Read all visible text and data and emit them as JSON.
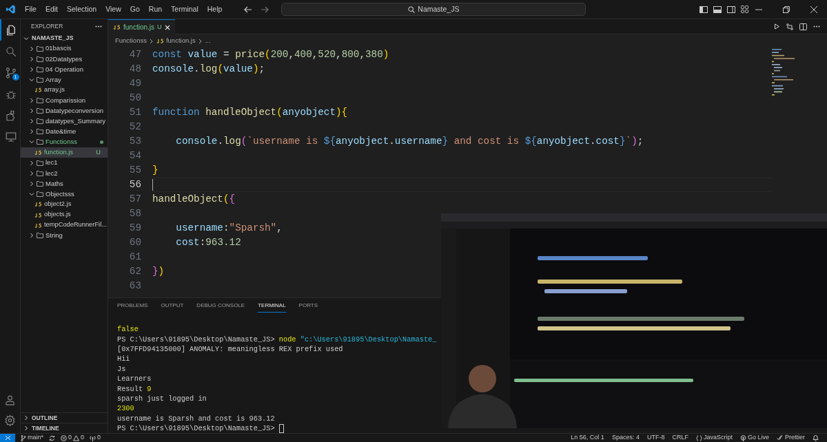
{
  "title_bar": {
    "menu": [
      "File",
      "Edit",
      "Selection",
      "View",
      "Go",
      "Run",
      "Terminal",
      "Help"
    ],
    "search": "Namaste_JS"
  },
  "activity_bar": [
    {
      "kind": "explorer",
      "selected": true
    },
    {
      "kind": "search",
      "selected": false
    },
    {
      "kind": "scm",
      "selected": false,
      "badge": "1"
    },
    {
      "kind": "debug",
      "selected": false
    },
    {
      "kind": "extensions",
      "selected": false
    },
    {
      "kind": "remote",
      "selected": false
    }
  ],
  "explorer": {
    "title": "EXPLORER",
    "root": "NAMASTE_JS",
    "tree": [
      {
        "kind": "folder",
        "label": "01bascis",
        "expanded": false,
        "selected": false,
        "modified": false
      },
      {
        "kind": "folder",
        "label": "02Datatypes",
        "expanded": false,
        "selected": false,
        "modified": false
      },
      {
        "kind": "folder",
        "label": "04 Operation",
        "expanded": false,
        "selected": false,
        "modified": false
      },
      {
        "kind": "folder",
        "label": "Array",
        "expanded": true,
        "selected": false,
        "modified": false,
        "children": [
          {
            "kind": "file",
            "label": "array.js",
            "selected": false,
            "modified": false
          }
        ]
      },
      {
        "kind": "folder",
        "label": "Comparission",
        "expanded": false,
        "selected": false,
        "modified": false
      },
      {
        "kind": "folder",
        "label": "Datatypeconversion",
        "expanded": false,
        "selected": false,
        "modified": false
      },
      {
        "kind": "folder",
        "label": "datatypes_Summary",
        "expanded": false,
        "selected": false,
        "modified": false
      },
      {
        "kind": "folder",
        "label": "Date&time",
        "expanded": false,
        "selected": false,
        "modified": false
      },
      {
        "kind": "folder",
        "label": "Functionss",
        "expanded": true,
        "selected": false,
        "modified": true,
        "children": [
          {
            "kind": "file",
            "label": "function.js",
            "selected": true,
            "modified": true,
            "status": "U"
          }
        ]
      },
      {
        "kind": "folder",
        "label": "lec1",
        "expanded": false,
        "selected": false,
        "modified": false
      },
      {
        "kind": "folder",
        "label": "lec2",
        "expanded": false,
        "selected": false,
        "modified": false
      },
      {
        "kind": "folder",
        "label": "Maths",
        "expanded": false,
        "selected": false,
        "modified": false
      },
      {
        "kind": "folder",
        "label": "Objectsss",
        "expanded": true,
        "selected": false,
        "modified": false,
        "children": [
          {
            "kind": "file",
            "label": "object2.js",
            "selected": false,
            "modified": false
          },
          {
            "kind": "file",
            "label": "objects.js",
            "selected": false,
            "modified": false
          },
          {
            "kind": "file",
            "label": "tempCodeRunnerFil...",
            "selected": false,
            "modified": false
          }
        ]
      },
      {
        "kind": "folder",
        "label": "String",
        "expanded": false,
        "selected": false,
        "modified": false
      }
    ],
    "sections": [
      "OUTLINE",
      "TIMELINE"
    ]
  },
  "editor": {
    "tabs": [
      {
        "label": "function.js",
        "status": "U",
        "selected": true
      }
    ],
    "breadcrumb": [
      "Functionss",
      "function.js",
      "..."
    ],
    "lines": [
      {
        "number": "47",
        "current": false,
        "tokens": [
          {
            "kind": "keyword",
            "text": "const "
          },
          {
            "kind": "variable",
            "text": "value"
          },
          {
            "kind": "plain",
            "text": " = "
          },
          {
            "kind": "function",
            "text": "price"
          },
          {
            "kind": "bracket1",
            "text": "("
          },
          {
            "kind": "number",
            "text": "200"
          },
          {
            "kind": "plain",
            "text": ","
          },
          {
            "kind": "number",
            "text": "400"
          },
          {
            "kind": "plain",
            "text": ","
          },
          {
            "kind": "number",
            "text": "520"
          },
          {
            "kind": "plain",
            "text": ","
          },
          {
            "kind": "number",
            "text": "800"
          },
          {
            "kind": "plain",
            "text": ","
          },
          {
            "kind": "number",
            "text": "380"
          },
          {
            "kind": "bracket1",
            "text": ")"
          }
        ]
      },
      {
        "number": "48",
        "current": false,
        "tokens": [
          {
            "kind": "variable",
            "text": "console"
          },
          {
            "kind": "plain",
            "text": "."
          },
          {
            "kind": "function",
            "text": "log"
          },
          {
            "kind": "bracket1",
            "text": "("
          },
          {
            "kind": "variable",
            "text": "value"
          },
          {
            "kind": "bracket1",
            "text": ")"
          },
          {
            "kind": "plain",
            "text": ";"
          }
        ]
      },
      {
        "number": "49",
        "current": false
      },
      {
        "number": "50",
        "current": false
      },
      {
        "number": "51",
        "current": false,
        "tokens": [
          {
            "kind": "keyword",
            "text": "function "
          },
          {
            "kind": "function",
            "text": "handleObject"
          },
          {
            "kind": "bracket1",
            "text": "("
          },
          {
            "kind": "variable",
            "text": "anyobject"
          },
          {
            "kind": "bracket1",
            "text": ")"
          },
          {
            "kind": "bracket1",
            "text": "{"
          }
        ]
      },
      {
        "number": "52",
        "current": false
      },
      {
        "number": "53",
        "current": false,
        "tokens": [
          {
            "kind": "variable",
            "text": "    console"
          },
          {
            "kind": "plain",
            "text": "."
          },
          {
            "kind": "function",
            "text": "log"
          },
          {
            "kind": "bracket2",
            "text": "("
          },
          {
            "kind": "string",
            "text": "`username is "
          },
          {
            "kind": "keyword",
            "text": "${"
          },
          {
            "kind": "variable",
            "text": "anyobject"
          },
          {
            "kind": "plain",
            "text": "."
          },
          {
            "kind": "variable",
            "text": "username"
          },
          {
            "kind": "keyword",
            "text": "}"
          },
          {
            "kind": "string",
            "text": " and cost is "
          },
          {
            "kind": "keyword",
            "text": "${"
          },
          {
            "kind": "variable",
            "text": "anyobject"
          },
          {
            "kind": "plain",
            "text": "."
          },
          {
            "kind": "variable",
            "text": "cost"
          },
          {
            "kind": "keyword",
            "text": "}"
          },
          {
            "kind": "string",
            "text": "`"
          },
          {
            "kind": "bracket2",
            "text": ")"
          },
          {
            "kind": "plain",
            "text": ";"
          }
        ]
      },
      {
        "number": "54",
        "current": false
      },
      {
        "number": "55",
        "current": false,
        "tokens": [
          {
            "kind": "bracket1",
            "text": "}"
          }
        ]
      },
      {
        "number": "56",
        "current": true
      },
      {
        "number": "57",
        "current": false,
        "tokens": [
          {
            "kind": "function",
            "text": "handleObject"
          },
          {
            "kind": "bracket1",
            "text": "("
          },
          {
            "kind": "bracket2",
            "text": "{"
          }
        ]
      },
      {
        "number": "58",
        "current": false
      },
      {
        "number": "59",
        "current": false,
        "tokens": [
          {
            "kind": "variable",
            "text": "    username"
          },
          {
            "kind": "plain",
            "text": ":"
          },
          {
            "kind": "string",
            "text": "\"Sparsh\""
          },
          {
            "kind": "plain",
            "text": ","
          }
        ]
      },
      {
        "number": "60",
        "current": false,
        "tokens": [
          {
            "kind": "variable",
            "text": "    cost"
          },
          {
            "kind": "plain",
            "text": ":"
          },
          {
            "kind": "number",
            "text": "963.12"
          }
        ]
      },
      {
        "number": "61",
        "current": false
      },
      {
        "number": "62",
        "current": false,
        "tokens": [
          {
            "kind": "bracket2",
            "text": "}"
          },
          {
            "kind": "bracket1",
            "text": ")"
          }
        ]
      },
      {
        "number": "63",
        "current": false
      }
    ]
  },
  "panel": {
    "tabs": [
      {
        "label": "PROBLEMS",
        "selected": false
      },
      {
        "label": "OUTPUT",
        "selected": false
      },
      {
        "label": "DEBUG CONSOLE",
        "selected": false
      },
      {
        "label": "TERMINAL",
        "selected": true
      },
      {
        "label": "PORTS",
        "selected": false
      }
    ],
    "terminal": {
      "cursor": true,
      "lines": [
        [
          {
            "kind": "highlight",
            "text": "false"
          }
        ],
        [
          {
            "kind": "plain",
            "text": "PS C:\\Users\\91895\\Desktop\\Namaste_JS> "
          },
          {
            "kind": "highlight",
            "text": "node "
          },
          {
            "kind": "path",
            "text": "\"c:\\Users\\91895\\Desktop\\Namaste_"
          }
        ],
        [
          {
            "kind": "plain",
            "text": "[0x7FFD94135000] ANOMALY: meaningless REX prefix used"
          }
        ],
        [
          {
            "kind": "plain",
            "text": "Hii"
          }
        ],
        [
          {
            "kind": "plain",
            "text": "Js"
          }
        ],
        [
          {
            "kind": "plain",
            "text": "Learners"
          }
        ],
        [
          {
            "kind": "plain",
            "text": "Result "
          },
          {
            "kind": "highlight",
            "text": "9"
          }
        ],
        [
          {
            "kind": "plain",
            "text": "sparsh just logged in"
          }
        ],
        [
          {
            "kind": "highlight",
            "text": "2300"
          }
        ],
        [
          {
            "kind": "plain",
            "text": "username is Sparsh and cost is 963.12"
          }
        ],
        [
          {
            "kind": "plain",
            "text": "PS C:\\Users\\91895\\Desktop\\Namaste_JS> "
          }
        ]
      ]
    }
  },
  "status_bar": {
    "left": [
      {
        "kind": "remote"
      },
      {
        "kind": "branch",
        "text": "main*"
      },
      {
        "kind": "sync"
      },
      {
        "kind": "problems",
        "errors": "0",
        "warnings": "0"
      },
      {
        "kind": "ports",
        "text": "0"
      }
    ],
    "right": [
      {
        "kind": "text",
        "text": "Ln 56, Col 1"
      },
      {
        "kind": "text",
        "text": "Spaces: 4"
      },
      {
        "kind": "text",
        "text": "UTF-8"
      },
      {
        "kind": "text",
        "text": "CRLF"
      },
      {
        "kind": "language",
        "text": "JavaScript"
      },
      {
        "kind": "golive",
        "text": "Go Live"
      },
      {
        "kind": "prettier",
        "text": "Prettier"
      },
      {
        "kind": "bell"
      }
    ]
  }
}
